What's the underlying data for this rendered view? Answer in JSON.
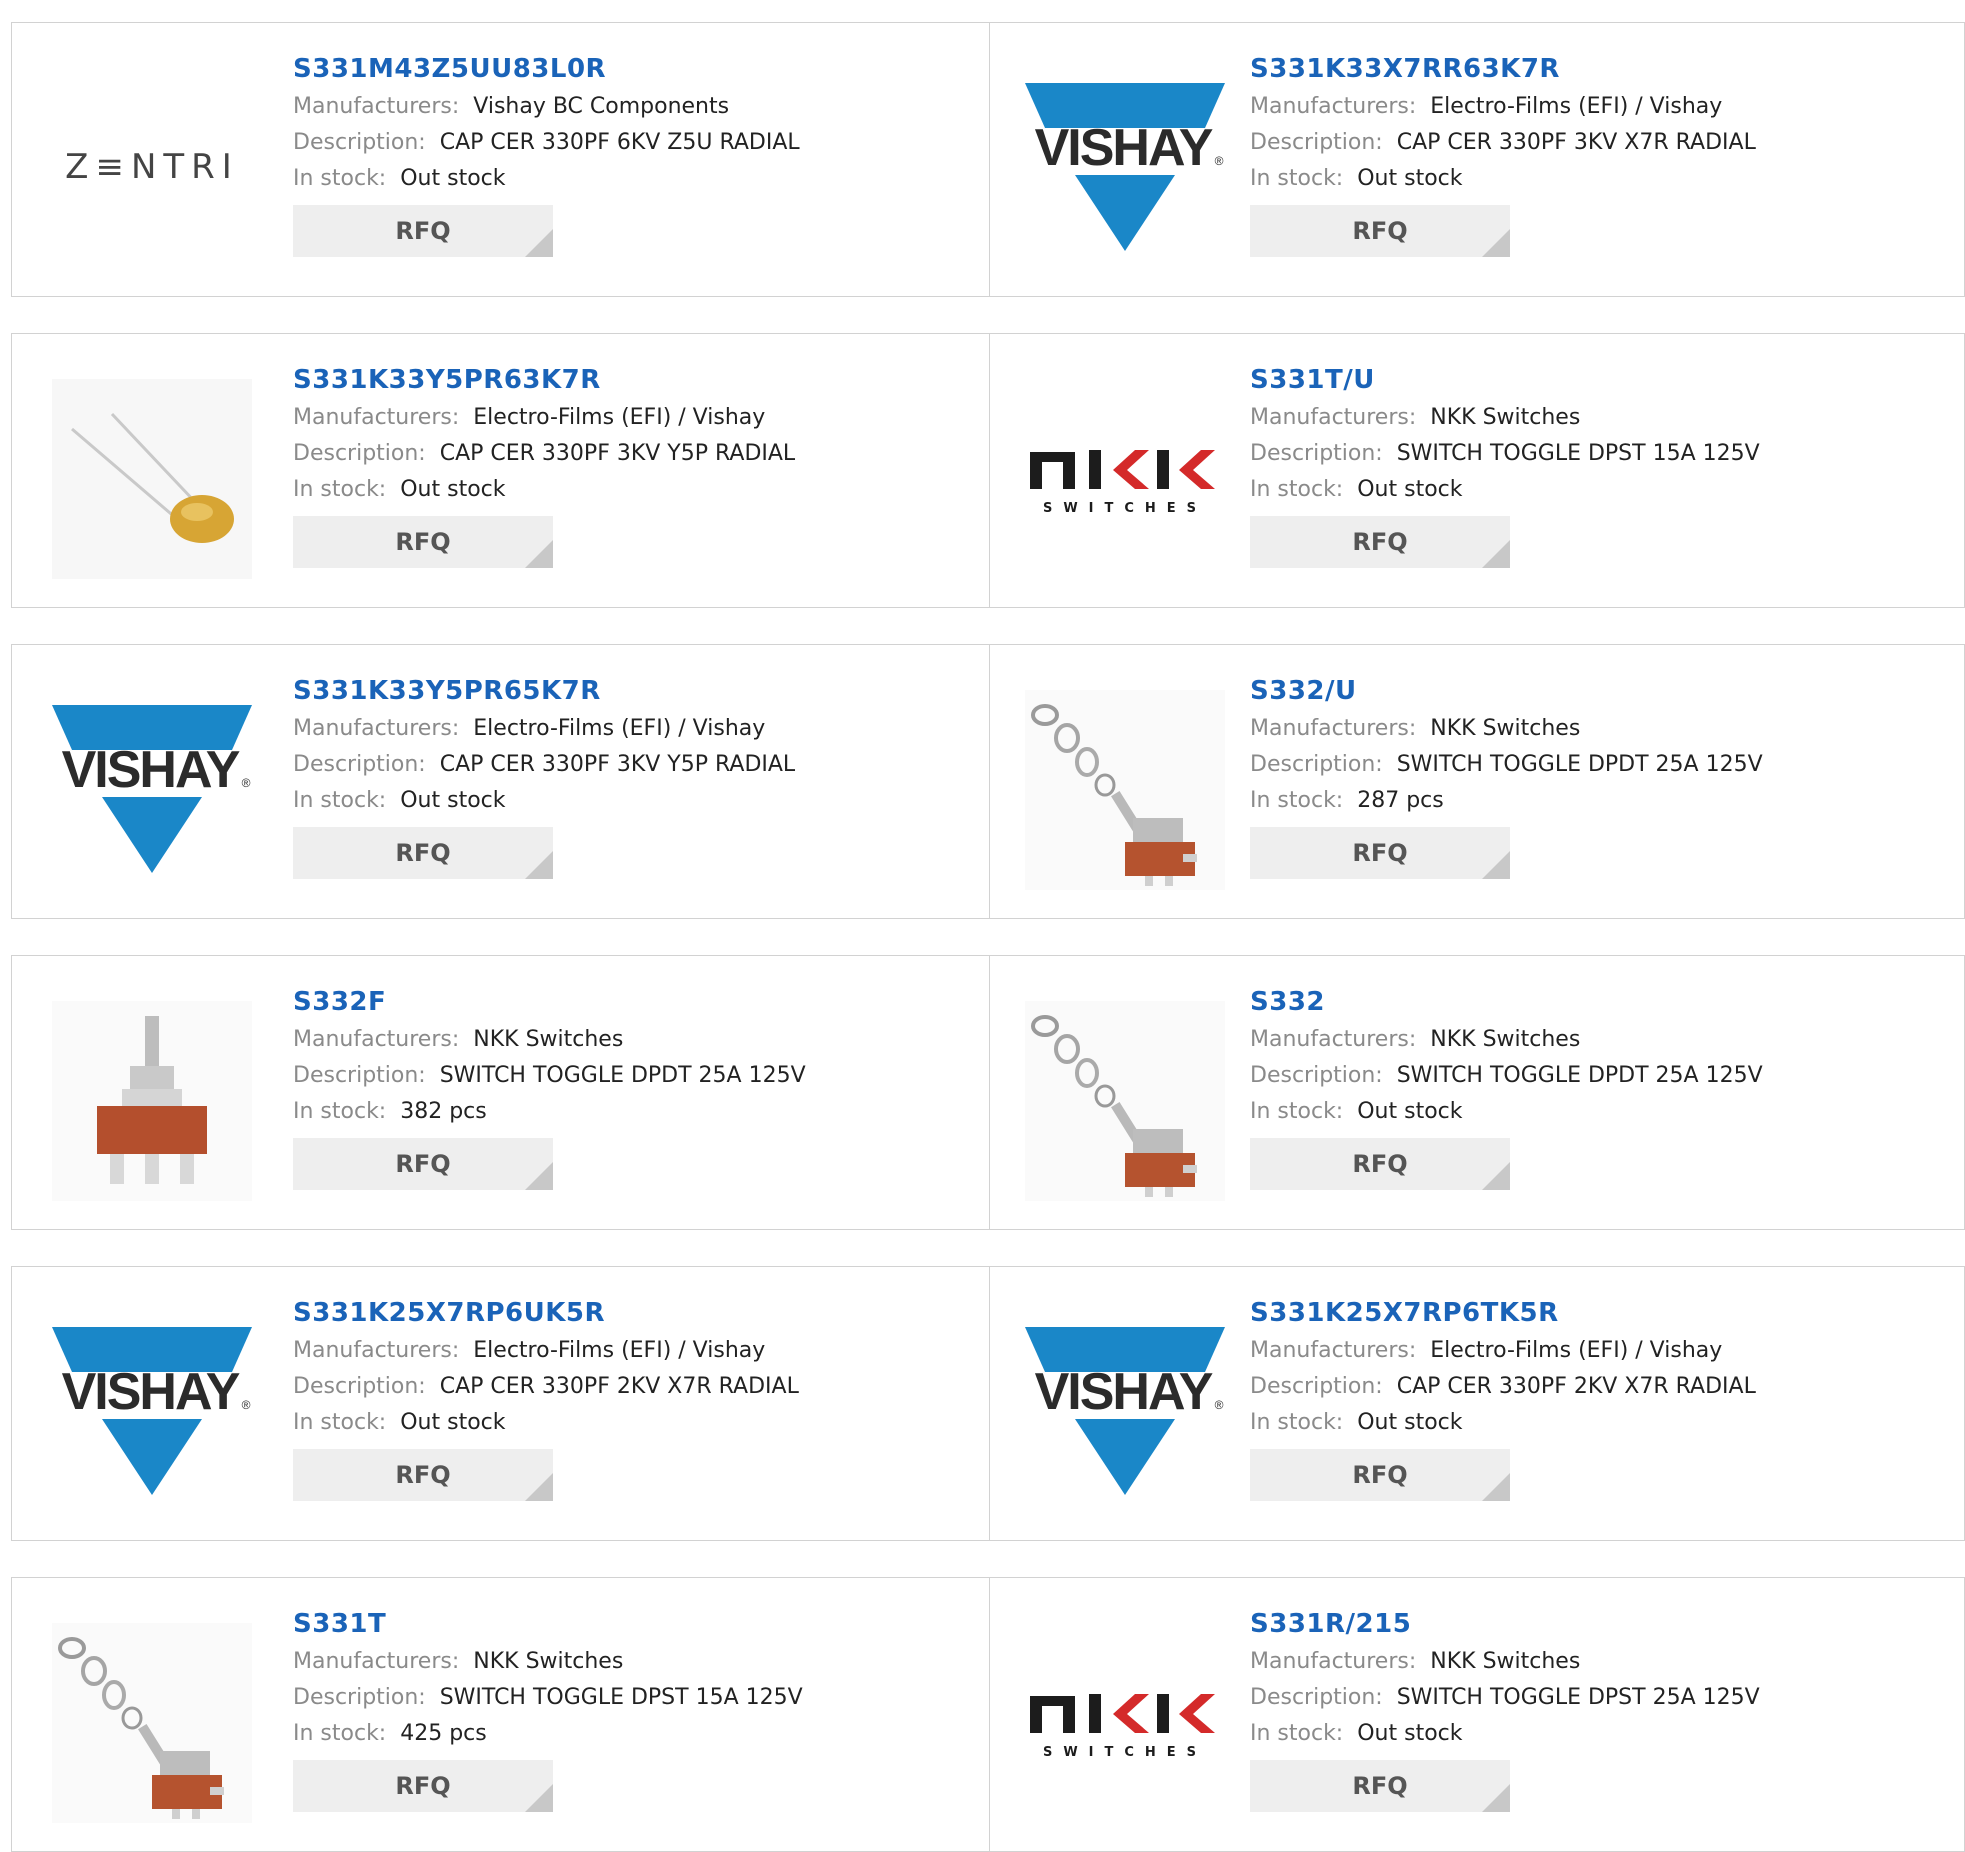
{
  "labels": {
    "manufacturers": "Manufacturers:",
    "description": "Description:",
    "stock": "In stock:",
    "rfq": "RFQ"
  },
  "logos": {
    "zentri": "Z≡NTRI",
    "vishay": "VISHAY",
    "vishay_mark": "®",
    "nkk_main": "NKK",
    "nkk_sub": "SWITCHES"
  },
  "colors": {
    "link": "#1a63b8",
    "vishay_blue": "#1a87c8",
    "nkk_red": "#d42a2a"
  },
  "products": [
    {
      "pn": "S331M43Z5UU83L0R",
      "manufacturer": "Vishay BC Components",
      "description": "CAP CER 330PF 6KV Z5U RADIAL",
      "stock": "Out stock",
      "image": "zentri-logo"
    },
    {
      "pn": "S331K33X7RR63K7R",
      "manufacturer": "Electro-Films (EFI) / Vishay",
      "description": "CAP CER 330PF 3KV X7R RADIAL",
      "stock": "Out stock",
      "image": "vishay-logo"
    },
    {
      "pn": "S331K33Y5PR63K7R",
      "manufacturer": "Electro-Films (EFI) / Vishay",
      "description": "CAP CER 330PF 3KV Y5P RADIAL",
      "stock": "Out stock",
      "image": "capacitor-photo"
    },
    {
      "pn": "S331T/U",
      "manufacturer": "NKK Switches",
      "description": "SWITCH TOGGLE DPST 15A 125V",
      "stock": "Out stock",
      "image": "nkk-logo"
    },
    {
      "pn": "S331K33Y5PR65K7R",
      "manufacturer": "Electro-Films (EFI) / Vishay",
      "description": "CAP CER 330PF 3KV Y5P RADIAL",
      "stock": "Out stock",
      "image": "vishay-logo"
    },
    {
      "pn": "S332/U",
      "manufacturer": "NKK Switches",
      "description": "SWITCH TOGGLE DPDT 25A 125V",
      "stock": "287 pcs",
      "image": "toggle-switch-photo"
    },
    {
      "pn": "S332F",
      "manufacturer": "NKK Switches",
      "description": "SWITCH TOGGLE DPDT 25A 125V",
      "stock": "382 pcs",
      "image": "toggle-switch-front-photo"
    },
    {
      "pn": "S332",
      "manufacturer": "NKK Switches",
      "description": "SWITCH TOGGLE DPDT 25A 125V",
      "stock": "Out stock",
      "image": "toggle-switch-photo"
    },
    {
      "pn": "S331K25X7RP6UK5R",
      "manufacturer": "Electro-Films (EFI) / Vishay",
      "description": "CAP CER 330PF 2KV X7R RADIAL",
      "stock": "Out stock",
      "image": "vishay-logo"
    },
    {
      "pn": "S331K25X7RP6TK5R",
      "manufacturer": "Electro-Films (EFI) / Vishay",
      "description": "CAP CER 330PF 2KV X7R RADIAL",
      "stock": "Out stock",
      "image": "vishay-logo"
    },
    {
      "pn": "S331T",
      "manufacturer": "NKK Switches",
      "description": "SWITCH TOGGLE DPST 15A 125V",
      "stock": "425 pcs",
      "image": "toggle-switch-photo"
    },
    {
      "pn": "S331R/215",
      "manufacturer": "NKK Switches",
      "description": "SWITCH TOGGLE DPST 25A 125V",
      "stock": "Out stock",
      "image": "nkk-logo"
    }
  ]
}
